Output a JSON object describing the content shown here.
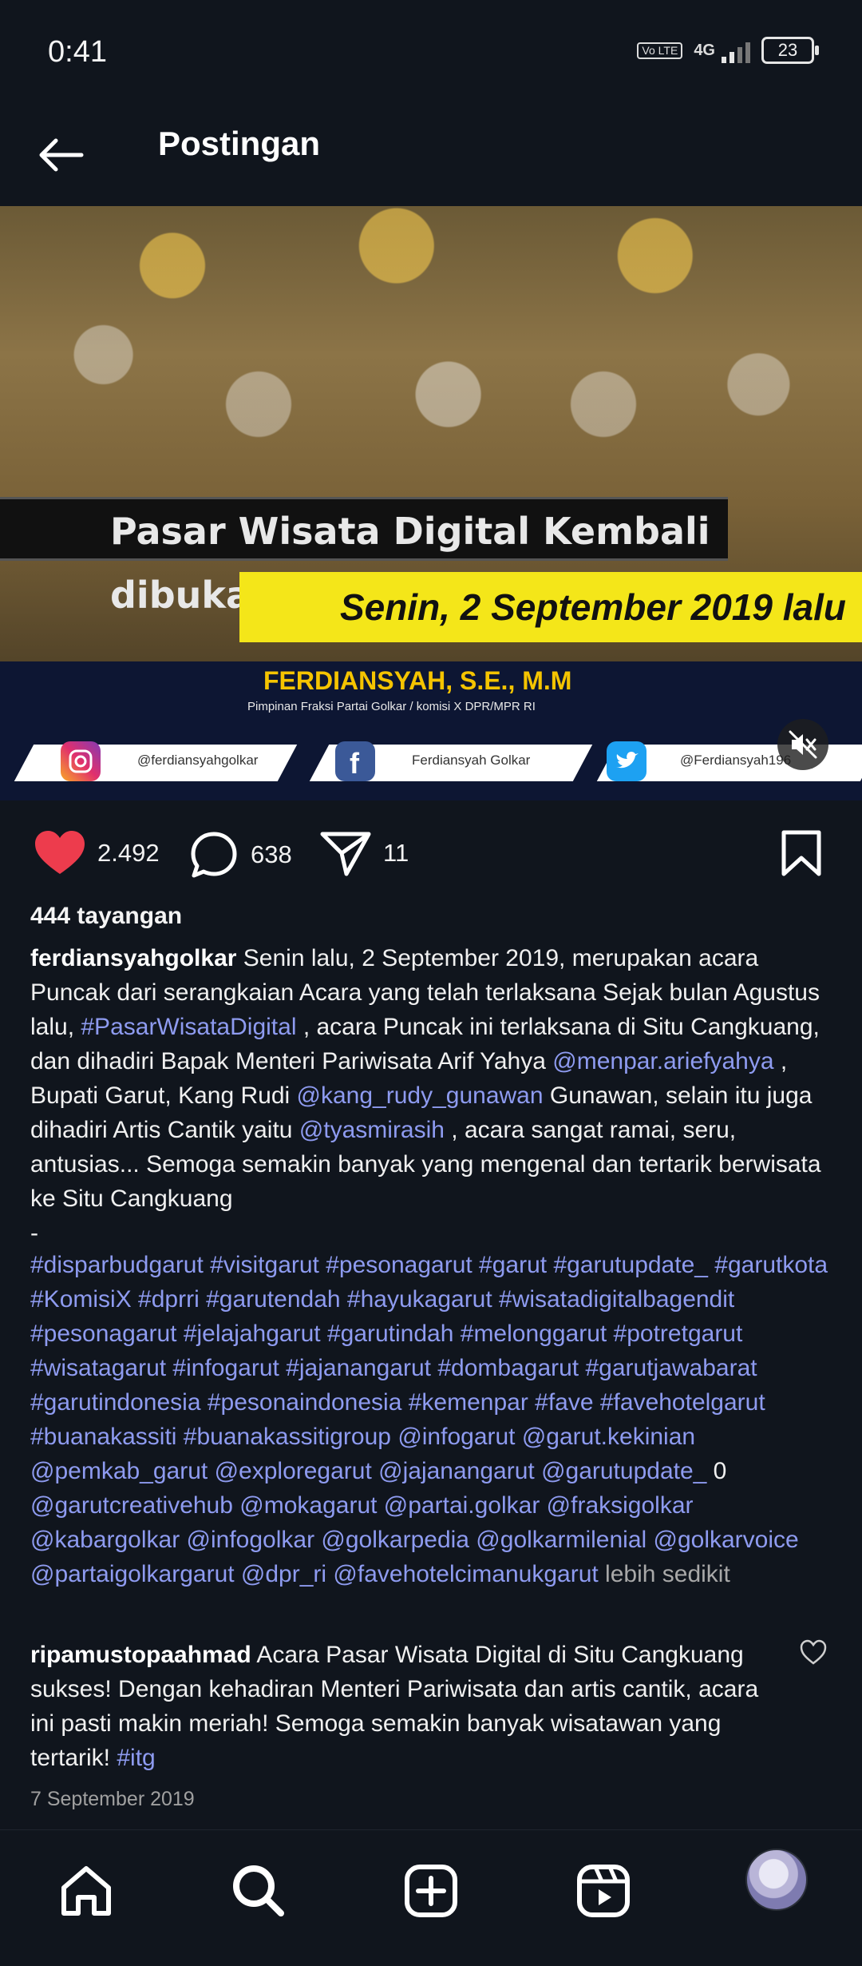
{
  "status_bar": {
    "time": "0:41",
    "volte": "Vo LTE",
    "network": "4G",
    "battery": "23"
  },
  "header": {
    "title": "Postingan"
  },
  "media": {
    "title": "Pasar Wisata Digital Kembali dibuka",
    "date": "Senin, 2 September 2019 lalu",
    "name": "FERDIANSYAH, S.E., M.M",
    "role": "Pimpinan Fraksi Partai Golkar / komisi X DPR/MPR RI",
    "instagram": "@ferdiansyahgolkar",
    "facebook": "Ferdiansyah Golkar",
    "twitter": "@Ferdiansyah196"
  },
  "actions": {
    "likes": "2.492",
    "comments": "638",
    "shares": "11"
  },
  "views": "444 tayangan",
  "caption": {
    "user": "ferdiansyahgolkar",
    "t1": " Senin lalu, 2 September 2019, merupakan acara Puncak dari serangkaian Acara yang telah terlaksana Sejak bulan Agustus lalu, ",
    "tag1": "#PasarWisataDigital",
    "t2": " , acara Puncak ini terlaksana di Situ Cangkuang, dan dihadiri Bapak Menteri Pariwisata Arif Yahya ",
    "mention1": "@menpar.ariefyahya",
    "t3": " , Bupati Garut, Kang Rudi ",
    "mention2": "@kang_rudy_gunawan",
    "t4": " Gunawan, selain itu juga dihadiri Artis Cantik yaitu ",
    "mention3": "@tyasmirasih",
    "t5": " , acara sangat ramai, seru, antusias... Semoga semakin banyak yang mengenal dan tertarik berwisata ke Situ Cangkuang",
    "dash": "-"
  },
  "hashtags": {
    "part1": "#disparbudgarut #visitgarut #pesonagarut #garut #garutupdate_ #garutkota #KomisiX #dprri #garutendah #hayukagarut #wisatadigitalbagendit #pesonagarut #jelajahgarut #garutindah #melonggarut #potretgarut #wisatagarut #infogarut #jajanangarut #dombagarut #garutjawabarat #garutindonesia #pesonaindonesia #kemenpar #fave #favehotelgarut #buanakassiti #buanakassitigroup @infogarut @garut.kekinian @pemkab_garut @exploregarut @jajanangarut @garutupdate_",
    "zero": " 0 ",
    "part2": "@garutcreativehub @mokagarut @partai.golkar @fraksigolkar @kabargolkar @infogolkar @golkarpedia @golkarmilenial @golkarvoice @partaigolkargarut @dpr_ri @favehotelcimanukgarut",
    "less": " lebih sedikit"
  },
  "comment": {
    "user": "ripamustopaahmad",
    "text": " Acara Pasar Wisata Digital di Situ Cangkuang sukses! Dengan kehadiran Menteri Pariwisata dan artis cantik, acara ini pasti makin meriah! Semoga semakin banyak wisatawan yang tertarik! ",
    "tag": "#itg"
  },
  "post_date": "7 September 2019",
  "icons": [
    "back-arrow-icon",
    "heart-icon",
    "comment-icon",
    "share-icon",
    "bookmark-icon",
    "mute-icon",
    "home-icon",
    "search-icon",
    "create-icon",
    "reels-icon"
  ],
  "colors": {
    "background": "#10151d",
    "link": "#8e9bf0",
    "like": "#ed3c4d",
    "banner_yellow": "#f4e619"
  }
}
